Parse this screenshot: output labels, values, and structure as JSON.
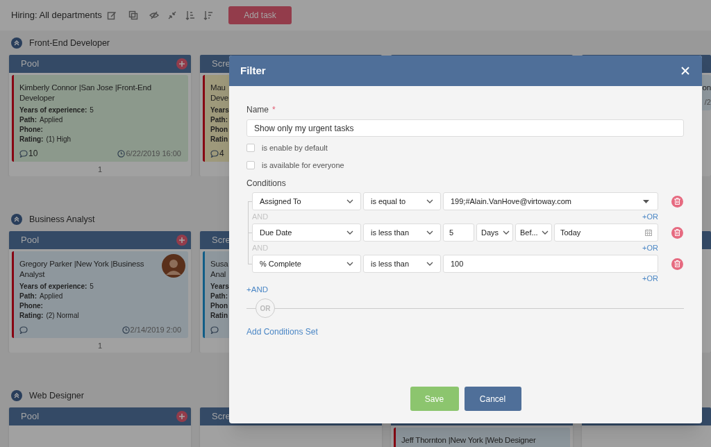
{
  "toolbar": {
    "title": "Hiring: All departments",
    "add_button": "Add task"
  },
  "sections": [
    {
      "title": "Front-End Developer",
      "columns": [
        {
          "title": "Pool",
          "addable": true,
          "count": "1",
          "cards": [
            {
              "title_lines": [
                "Kimberly Connor |San Jose |Front-End",
                "Developer"
              ],
              "color": "#870112",
              "kind": "green",
              "fields": [
                {
                  "label": "Years of experience:",
                  "value": "5"
                },
                {
                  "label": "Path:",
                  "value": "Applied"
                },
                {
                  "label": "Phone:"
                },
                {
                  "label": "Rating:",
                  "value": "(1) High"
                }
              ],
              "comments": "10",
              "date": "6/22/2019 16:00"
            }
          ]
        },
        {
          "title": "Scre",
          "cards": [
            {
              "title_lines": [
                "Mau",
                "Deve"
              ],
              "color": "#870112",
              "kind": "yellow",
              "fields": [
                {
                  "label": "Years"
                },
                {
                  "label": "Path:"
                },
                {
                  "label": "Phon"
                },
                {
                  "label": "Ratin"
                }
              ],
              "comments": "4"
            }
          ]
        },
        {},
        {
          "cut_at_edge": true,
          "cards": [
            {
              "title_lines": [
                "on"
              ],
              "kind": "blue",
              "date": "/2"
            }
          ]
        }
      ]
    },
    {
      "title": "Business Analyst",
      "columns": [
        {
          "title": "Pool",
          "addable": true,
          "count": "1",
          "cards": [
            {
              "title_lines": [
                "Gregory Parker |New York |Business",
                "Analyst"
              ],
              "color": "#870112",
              "kind": "blue",
              "avatar": true,
              "fields": [
                {
                  "label": "Years of experience:",
                  "value": "5"
                },
                {
                  "label": "Path:",
                  "value": "Applied"
                },
                {
                  "label": "Phone:"
                },
                {
                  "label": "Rating:",
                  "value": "(2) Normal"
                }
              ],
              "date": "2/14/2019 2:00"
            }
          ]
        },
        {
          "title": "Scre",
          "cards": [
            {
              "title_lines": [
                "Susa",
                "Anal"
              ],
              "color": "#115d87",
              "kind": "blue",
              "fields": [
                {
                  "label": "Years"
                },
                {
                  "label": "Path:"
                },
                {
                  "label": "Phon"
                },
                {
                  "label": "Ratin"
                }
              ]
            }
          ]
        },
        {},
        {
          "cut_at_edge": true
        }
      ]
    },
    {
      "title": "Web Designer",
      "columns": [
        {
          "title": "Pool",
          "addable": true
        },
        {
          "title": "Scre"
        },
        {
          "cards": [
            {
              "title_lines": [
                "Jeff Thornton |New York |Web Designer"
              ],
              "color": "#870112",
              "kind": "blue"
            }
          ]
        },
        {
          "cut_at_edge": true
        }
      ]
    }
  ],
  "filter_dialog": {
    "title": "Filter",
    "name_label": "Name",
    "required_mark": "*",
    "name_value": "Show only my urgent tasks",
    "options": [
      {
        "label": "is enable by default",
        "checked": false
      },
      {
        "label": "is available for everyone",
        "checked": false
      }
    ],
    "conditions_label": "Conditions",
    "conditions": [
      {
        "field": "Assigned To",
        "operator": "is equal to",
        "kind": "lookup",
        "value": "199;#Alain.VanHove@virtoway.com",
        "joiner": "AND",
        "add_or": "+OR"
      },
      {
        "field": "Due Date",
        "operator": "is less than",
        "kind": "date_offset",
        "amount": "5",
        "unit": "Days",
        "direction": "Bef...",
        "reference": "Today",
        "joiner": "AND",
        "add_or": "+OR"
      },
      {
        "field": "% Complete",
        "operator": "is less than",
        "kind": "text",
        "value": "100",
        "add_or": "+OR"
      }
    ],
    "add_and": "+AND",
    "or_divider": "OR",
    "add_set": "Add Conditions Set",
    "buttons": [
      {
        "label": "Save",
        "kind": "primary"
      },
      {
        "label": "Cancel",
        "kind": "secondary"
      }
    ]
  }
}
